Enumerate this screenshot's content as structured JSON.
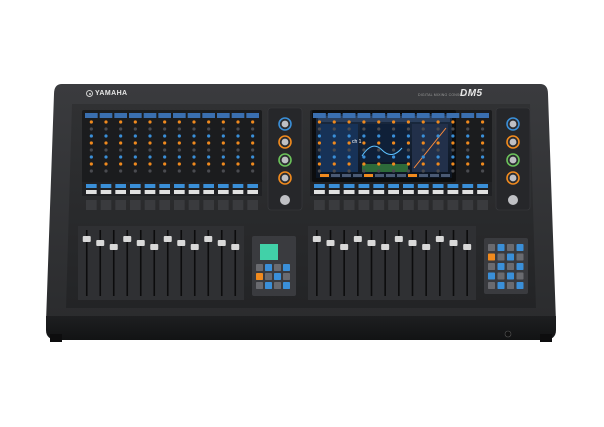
{
  "console": {
    "brand": "YAMAHA",
    "model": "DM5",
    "subtitle": "DIGITAL MIXING CONSOLE",
    "screen_channel": "ch 1"
  },
  "colors": {
    "background": "#ffffff",
    "chassis": "#2a2b2d",
    "chassis_dark": "#1a1b1d",
    "accent_orange": "#f08a1e",
    "accent_blue": "#3a8fd8",
    "accent_green": "#6bc25a"
  },
  "counts": {
    "left_strips": 12,
    "right_strips": 12,
    "left_faders": 12,
    "right_faders": 12
  }
}
